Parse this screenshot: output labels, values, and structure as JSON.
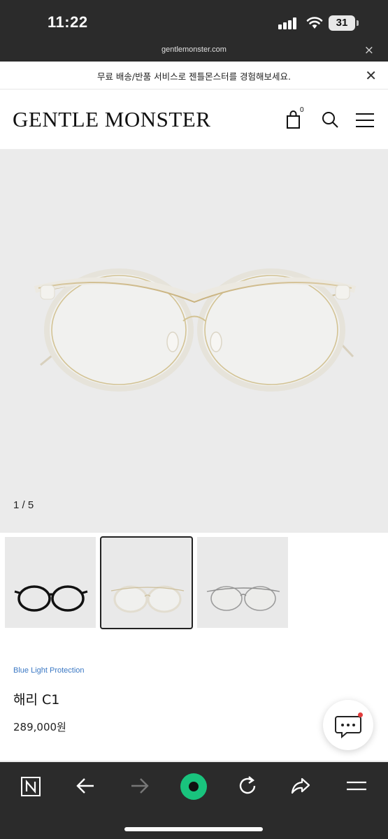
{
  "status_bar": {
    "time": "11:22",
    "battery": "31"
  },
  "browser": {
    "url": "gentlemonster.com",
    "close_glyph": "×"
  },
  "promo": {
    "text": "무료 배송/반품 서비스로 젠틀몬스터를 경험해보세요.",
    "close_glyph": "✕"
  },
  "header": {
    "logo": "GENTLE MONSTER",
    "bag_count": "0"
  },
  "gallery": {
    "counter": "1 / 5",
    "background": "#ebebeb",
    "thumbnails": [
      {
        "label": "black frame",
        "selected": false
      },
      {
        "label": "clear frame",
        "selected": true
      },
      {
        "label": "clear silver frame",
        "selected": false
      }
    ]
  },
  "product": {
    "tag": "Blue Light Protection",
    "name": "해리 C1",
    "price": "289,000원",
    "tag_color": "#3b78c4"
  },
  "chat": {
    "icon": "chat-bubble-icon",
    "badge_color": "#e23c3c"
  },
  "toolbar": {
    "items": [
      "naver-n-icon",
      "back-icon",
      "forward-icon",
      "green-home-icon",
      "refresh-icon",
      "share-icon",
      "menu-icon"
    ],
    "accent": "#19c37d"
  }
}
